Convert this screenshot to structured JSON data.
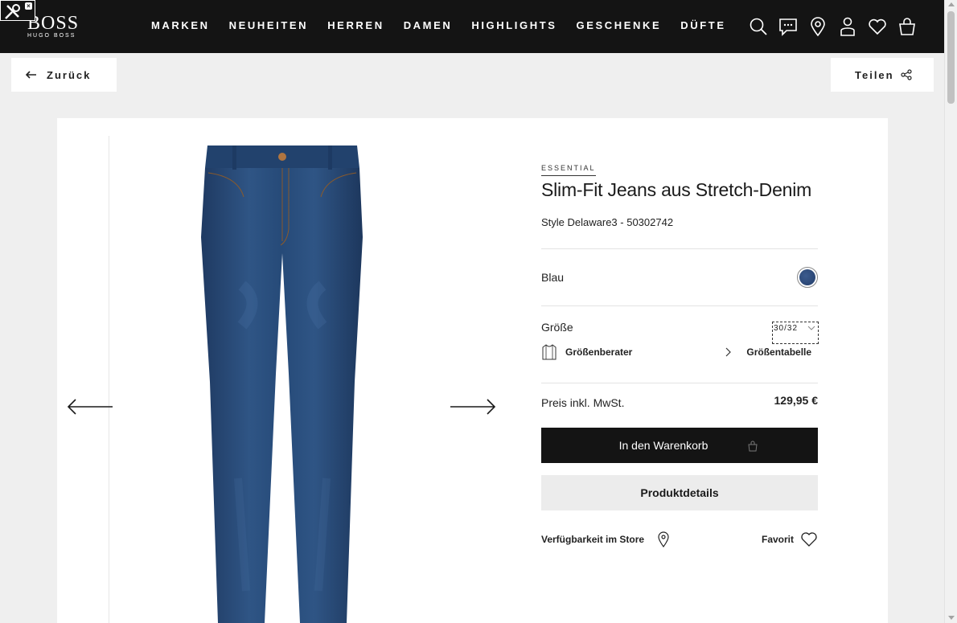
{
  "brand": {
    "name": "BOSS",
    "tagline": "HUGO BOSS"
  },
  "nav": {
    "items": [
      "MARKEN",
      "NEUHEITEN",
      "HERREN",
      "DAMEN",
      "HIGHLIGHTS",
      "GESCHENKE",
      "DÜFTE"
    ]
  },
  "header_icons": [
    "search-icon",
    "chat-icon",
    "location-icon",
    "account-icon",
    "wishlist-icon",
    "cart-icon"
  ],
  "actions": {
    "back_label": "Zurück",
    "share_label": "Teilen"
  },
  "product": {
    "eyebrow": "ESSENTIAL",
    "title": "Slim-Fit Jeans aus Stretch-Denim",
    "style": "Style Delaware3 - 50302742",
    "color_label": "Blau",
    "size_label": "Größe",
    "size_value": "30/32",
    "size_advisor": "Größenberater",
    "size_table": "Größentabelle",
    "price_label": "Preis inkl. MwSt.",
    "price": "129,95 €",
    "cart_button": "In den Warenkorb",
    "details_button": "Produktdetails",
    "store_availability": "Verfügbarkeit im Store",
    "favorite": "Favorit"
  },
  "colors": {
    "header_bg": "#141414",
    "page_bg": "#efefef",
    "denim": "#2d4f7e"
  }
}
